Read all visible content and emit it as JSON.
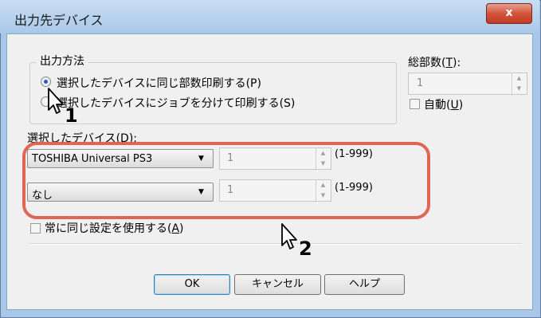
{
  "window": {
    "title": "出力先デバイス",
    "close_label": "x"
  },
  "output_method": {
    "group_label": "出力方法",
    "option_same": "選択したデバイスに同じ部数印刷する(P)",
    "option_split": "選択したデバイスにジョブを分けて印刷する(S)",
    "selected": "option_same"
  },
  "total_copies": {
    "label_prefix": "総部数(",
    "mnemonic": "T",
    "label_suffix": "):",
    "value": "1",
    "auto_label_prefix": "自動(",
    "auto_mnemonic": "U",
    "auto_label_suffix": ")",
    "auto_checked": false
  },
  "selected_devices": {
    "label": "選択したデバイス(D):",
    "devices": [
      {
        "name": "TOSHIBA Universal PS3",
        "copies": "1",
        "range": "(1-999)"
      },
      {
        "name": "なし",
        "copies": "1",
        "range": "(1-999)"
      }
    ]
  },
  "always_same": {
    "label_prefix": "常に同じ設定を使用する(",
    "mnemonic": "A",
    "label_suffix": ")",
    "checked": false
  },
  "buttons": {
    "ok": "OK",
    "cancel": "キャンセル",
    "help": "ヘルプ"
  },
  "callouts": {
    "one": "1",
    "two": "2"
  },
  "colors": {
    "highlight": "#e06555",
    "close": "#c23b22",
    "title_bar": "#a9c8e8"
  }
}
